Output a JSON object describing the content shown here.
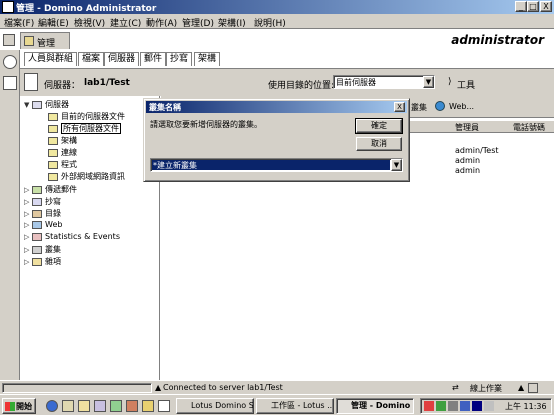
{
  "window": {
    "title": "管理 - Domino Administrator",
    "minimize": "_",
    "maximize": "□",
    "close": "X"
  },
  "menu": {
    "items": [
      "檔案(F)",
      "編輯(E)",
      "檢視(V)",
      "建立(C)",
      "動作(A)",
      "管理(D)",
      "架構(I)",
      "說明(H)"
    ]
  },
  "tabstrip": {
    "home_tab": "管理",
    "user_label": "administrator"
  },
  "admin_tabs": [
    "人員與群組",
    "檔案",
    "伺服器",
    "郵件",
    "抄寫",
    "架構"
  ],
  "serverbar": {
    "server_label": "伺服器：",
    "server_name": "lab1/Test",
    "location_label": "使用目錄的位置:",
    "location_value": "目前伺服器",
    "tools_label": "工具"
  },
  "tree": {
    "root": "伺服器",
    "children": [
      "目前的伺服器文件",
      "所有伺服器文件",
      "架構",
      "連線",
      "程式",
      "外部網域網路資訊"
    ],
    "others": [
      "傳遞郵件",
      "抄寫",
      "目錄",
      "Web",
      "Statistics & Events",
      "叢集",
      "雜項"
    ]
  },
  "rightpane": {
    "toolbar_cluster": "叢集",
    "toolbar_web": "Web...",
    "col_admin": "管理員",
    "col_phone": "電話號碼",
    "rows": [
      "admin/Test",
      "admin",
      "admin"
    ]
  },
  "dialog": {
    "title": "叢集名稱",
    "prompt": "請選取您要新增伺服器的叢集。",
    "ok": "確定",
    "cancel": "取消",
    "select_value": "*建立新叢集",
    "close": "X"
  },
  "statusbar": {
    "text": "Connected to server lab1/Test",
    "online": "線上作業"
  },
  "taskbar": {
    "start": "開始",
    "tasks": [
      "Lotus Domino S...",
      "工作區 - Lotus ...",
      "管理 - Domino ..."
    ],
    "time": "上午 11:36"
  },
  "colors": {
    "titlebar_start": "#0a246a",
    "titlebar_end": "#a6caf0",
    "face": "#d4d0c8",
    "selection": "#0a246a"
  }
}
